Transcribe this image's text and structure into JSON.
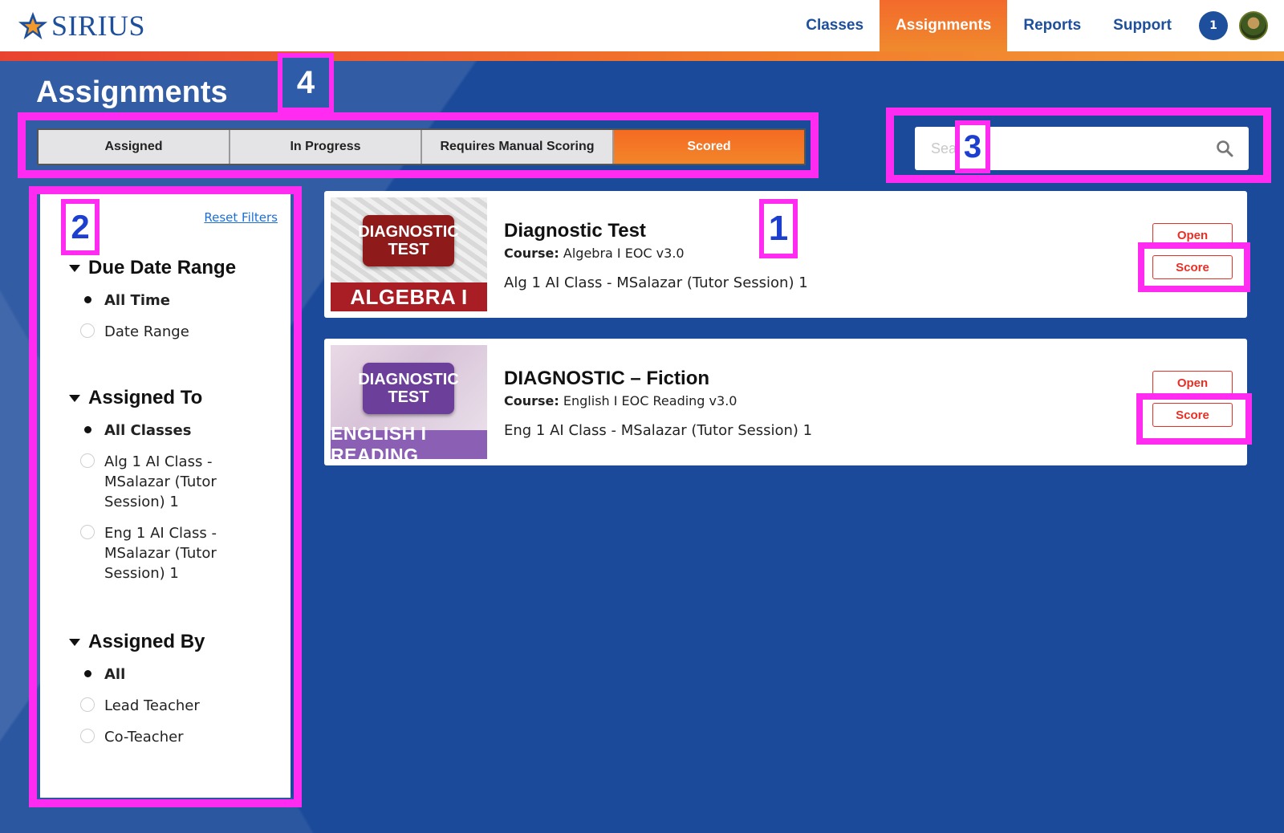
{
  "header": {
    "logo_text": "SIRIUS",
    "nav": [
      "Classes",
      "Assignments",
      "Reports",
      "Support"
    ],
    "notification_count": "1"
  },
  "page": {
    "title": "Assignments"
  },
  "tabs": [
    "Assigned",
    "In Progress",
    "Requires Manual Scoring",
    "Scored"
  ],
  "search": {
    "placeholder": "Search"
  },
  "filters": {
    "reset_label": "Reset Filters",
    "due_date": {
      "title": "Due Date Range",
      "options": [
        "All Time",
        "Date Range"
      ]
    },
    "assigned_to": {
      "title": "Assigned To",
      "options": [
        "All Classes",
        "Alg 1 AI Class - MSalazar (Tutor Session) 1",
        "Eng 1 AI Class - MSalazar (Tutor Session) 1"
      ]
    },
    "assigned_by": {
      "title": "Assigned By",
      "options": [
        "All",
        "Lead Teacher",
        "Co-Teacher"
      ]
    }
  },
  "cards": [
    {
      "title": "Diagnostic Test",
      "course_label": "Course:",
      "course": "Algebra I EOC v3.0",
      "class": "Alg 1 AI Class - MSalazar (Tutor Session) 1",
      "thumb_badge_1": "DIAGNOSTIC",
      "thumb_badge_2": "TEST",
      "thumb_banner": "ALGEBRA I",
      "open_label": "Open",
      "score_label": "Score"
    },
    {
      "title": "DIAGNOSTIC – Fiction",
      "course_label": "Course:",
      "course": "English I EOC Reading v3.0",
      "class": "Eng 1 AI Class - MSalazar (Tutor Session) 1",
      "thumb_badge_1": "DIAGNOSTIC",
      "thumb_badge_2": "TEST",
      "thumb_banner": "ENGLISH I READING",
      "open_label": "Open",
      "score_label": "Score"
    }
  ],
  "annotations": [
    "1",
    "2",
    "3",
    "4"
  ],
  "colors": {
    "brand_blue": "#1d4f9c",
    "accent_orange": "#f36a2c",
    "annotation_magenta": "#ff2bf0",
    "button_red": "#e53026"
  }
}
